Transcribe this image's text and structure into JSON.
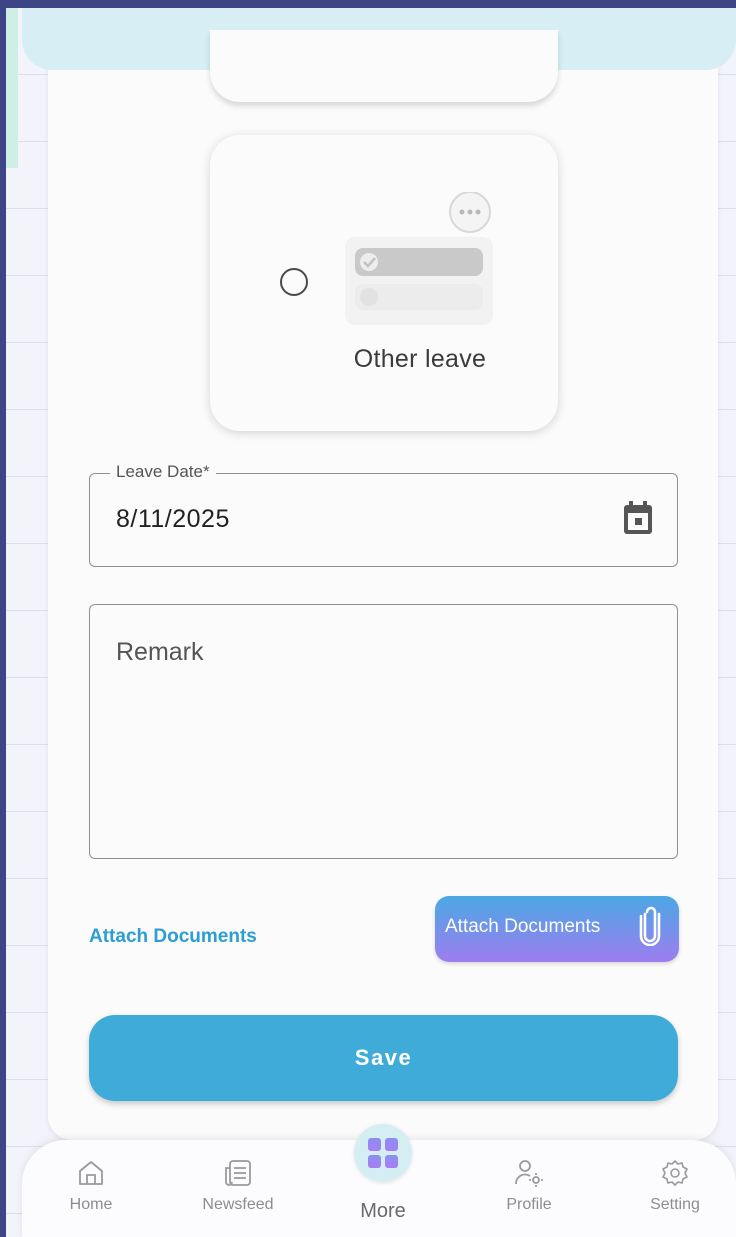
{
  "leave_option": {
    "label": "Other leave",
    "selected": false,
    "icon": "other-leave-illustration"
  },
  "leave_date": {
    "label": "Leave Date*",
    "value": "8/11/2025",
    "icon": "calendar-icon"
  },
  "remark": {
    "placeholder": "Remark"
  },
  "attach": {
    "link_label": "Attach Documents",
    "button_label": "Attach Documents",
    "icon": "paperclip-icon"
  },
  "save": {
    "label": "Save"
  },
  "nav": {
    "items": [
      {
        "label": "Home",
        "icon": "home-icon"
      },
      {
        "label": "Newsfeed",
        "icon": "newsfeed-icon"
      },
      {
        "label": "More",
        "icon": "grid-icon"
      },
      {
        "label": "Profile",
        "icon": "profile-settings-icon"
      },
      {
        "label": "Setting",
        "icon": "gear-icon"
      }
    ]
  },
  "colors": {
    "accent": "#3fabd9",
    "gradient_start": "#4ba8e3",
    "gradient_end": "#9d7df0",
    "frame": "#3d4587"
  }
}
